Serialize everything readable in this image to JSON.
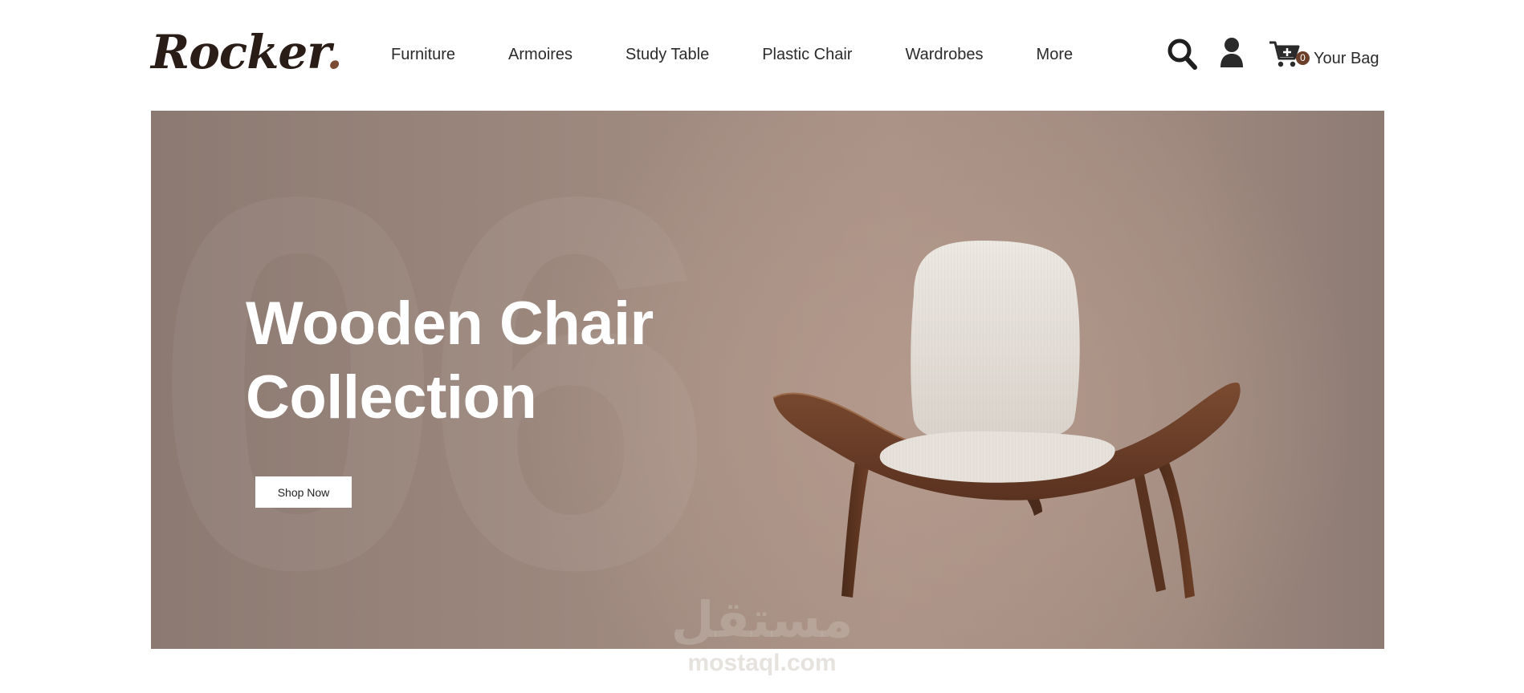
{
  "header": {
    "logo_text": "Rocker",
    "logo_dot": ".",
    "nav": [
      {
        "label": "Furniture"
      },
      {
        "label": "Armoires"
      },
      {
        "label": "Study Table"
      },
      {
        "label": "Plastic Chair"
      },
      {
        "label": "Wardrobes"
      },
      {
        "label": "More"
      }
    ],
    "icons": [
      "search-icon",
      "user-icon",
      "cart-icon"
    ],
    "cart_count": "0",
    "bag_label": "Your Bag"
  },
  "hero": {
    "background_digits": "06",
    "title": "Wooden Chair Collection",
    "cta_label": "Shop Now",
    "image": "lounge-chair"
  },
  "watermark": {
    "arabic": "مستقل",
    "url": "mostaql.com"
  },
  "colors": {
    "brand_dark": "#2a1d18",
    "brand_accent": "#6b3e29",
    "hero_bg": "#a08b80",
    "hero_text": "#ffffff"
  }
}
